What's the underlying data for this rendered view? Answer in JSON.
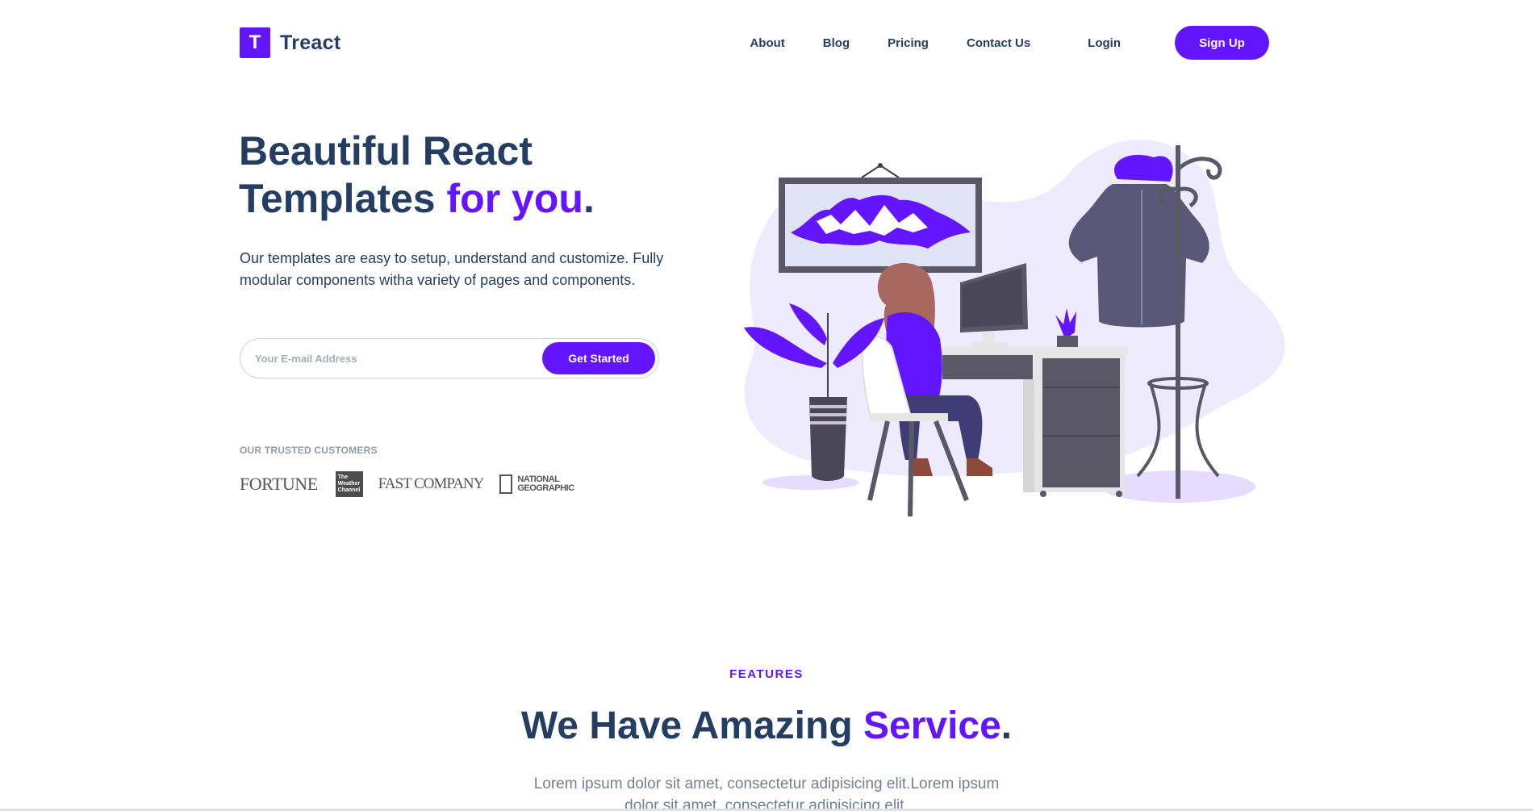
{
  "brand": {
    "mark": "T",
    "name": "Treact"
  },
  "nav": {
    "links": [
      "About",
      "Blog",
      "Pricing",
      "Contact Us"
    ],
    "login": "Login",
    "signup": "Sign Up"
  },
  "hero": {
    "title_line1": "Beautiful React",
    "title_line2_main": "Templates ",
    "title_line2_accent": "for you",
    "title_line2_end": ".",
    "description": "Our templates are easy to setup, understand and customize. Fully modular components witha variety of pages and components.",
    "email_placeholder": "Your E-mail Address",
    "cta": "Get Started",
    "trusted_label": "OUR TRUSTED CUSTOMERS",
    "logos": {
      "fortune": "FORTUNE",
      "weather": "The Weather Channel",
      "fast": "FAST COMPANY",
      "natgeo_line1": "NATIONAL",
      "natgeo_line2": "GEOGRAPHIC"
    }
  },
  "features": {
    "subheading": "FEATURES",
    "title_main": "We Have Amazing ",
    "title_accent": "Service",
    "title_end": ".",
    "description": "Lorem ipsum dolor sit amet, consectetur adipisicing elit.Lorem ipsum dolor sit amet, consectetur adipisicing elit."
  },
  "colors": {
    "primary": "#6415ff",
    "heading": "#243e63",
    "muted": "#718096",
    "blob": "#efebfe"
  }
}
